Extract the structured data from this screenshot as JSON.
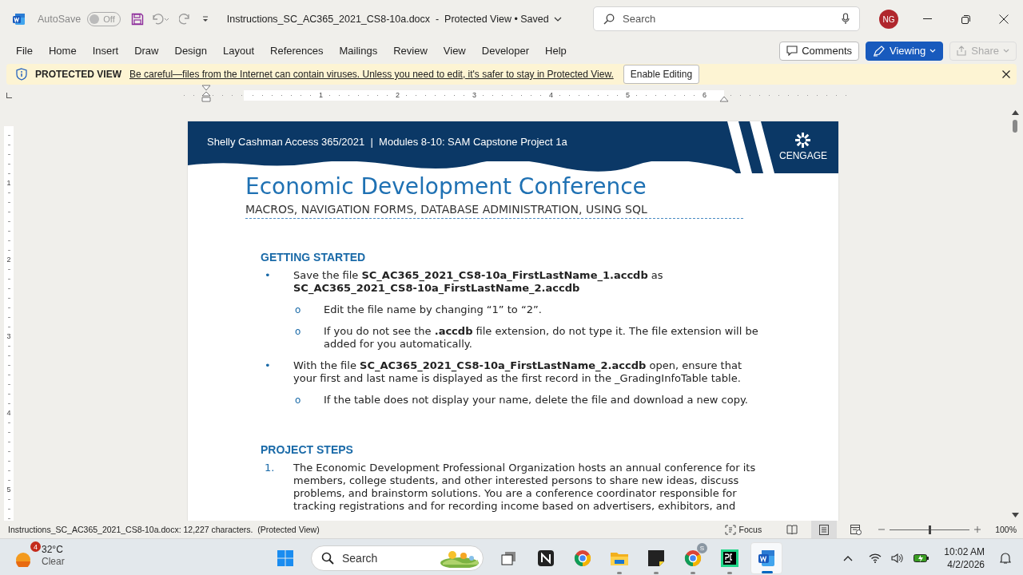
{
  "title_bar": {
    "autosave": {
      "label": "AutoSave",
      "state": "Off",
      "on": false
    },
    "document_title": "Instructions_SC_AC365_2021_CS8-10a.docx  -  Protected View • Saved",
    "search": {
      "placeholder": "Search"
    },
    "avatar": "NG"
  },
  "ribbon": {
    "tabs": [
      {
        "label": "File",
        "selected": false
      },
      {
        "label": "Home",
        "selected": false
      },
      {
        "label": "Insert",
        "selected": false
      },
      {
        "label": "Draw",
        "selected": false
      },
      {
        "label": "Design",
        "selected": false
      },
      {
        "label": "Layout",
        "selected": false
      },
      {
        "label": "References",
        "selected": false
      },
      {
        "label": "Mailings",
        "selected": false
      },
      {
        "label": "Review",
        "selected": false
      },
      {
        "label": "View",
        "selected": false
      },
      {
        "label": "Developer",
        "selected": false
      },
      {
        "label": "Help",
        "selected": false
      }
    ],
    "buttons": [
      {
        "kind": "comments",
        "label": "Comments",
        "disabled": false
      },
      {
        "kind": "viewing",
        "label": "Viewing",
        "disabled": false
      },
      {
        "kind": "share",
        "label": "Share",
        "disabled": true
      }
    ]
  },
  "protected_view": {
    "title": "PROTECTED VIEW",
    "message": "Be careful—files from the Internet can contain viruses. Unless you need to edit, it's safer to stay in Protected View.",
    "button": "Enable Editing"
  },
  "ruler": {
    "horizontal": [
      "1",
      "2",
      "3",
      "4",
      "5",
      "6"
    ],
    "vertical": [
      "1",
      "2",
      "3",
      "4",
      "5"
    ]
  },
  "document": {
    "banner": "Shelly Cashman Access 365/2021  |  Modules 8-10: SAM Capstone Project 1a",
    "brand": "CENGAGE",
    "title": "Economic Development Conference",
    "subtitle": "MACROS, NAVIGATION FORMS, DATABASE ADMINISTRATION, USING SQL",
    "sections": [
      {
        "heading": "GETTING STARTED",
        "items": [
          {
            "marker": "•",
            "text": "Save the file **SC_AC365_2021_CS8-10a_FirstLastName_1.accdb** as **SC_AC365_2021_CS8-10a_FirstLastName_2.accdb**",
            "children": [
              {
                "marker": "o",
                "text": "Edit the file name by changing “1” to “2”."
              },
              {
                "marker": "o",
                "text": "If you do not see the **.accdb** file extension, do not type it. The file extension will be added for you automatically."
              }
            ]
          },
          {
            "marker": "•",
            "text": "With the file **SC_AC365_2021_CS8-10a_FirstLastName_2.accdb** open, ensure that your first and last name is displayed as the first record in the _GradingInfoTable table.",
            "children": [
              {
                "marker": "o",
                "text": "If the table does not display your name, delete the file and download a new copy."
              }
            ]
          }
        ]
      },
      {
        "heading": "PROJECT STEPS",
        "items": [
          {
            "marker": "1.",
            "text": "The Economic Development Professional Organization hosts an annual conference for its members, college students, and other interested persons to share new ideas, discuss problems, and brainstorm solutions. You are a conference coordinator responsible for tracking registrations and for recording income based on advertisers, exhibitors, and"
          }
        ]
      }
    ]
  },
  "status_bar": {
    "text": "Instructions_SC_AC365_2021_CS8-10a.docx: 12,227 characters.  (Protected View)",
    "focus": "Focus",
    "views": [
      {
        "kind": "read",
        "selected": false
      },
      {
        "kind": "print",
        "selected": true
      },
      {
        "kind": "web",
        "selected": false
      }
    ],
    "zoom": {
      "level": 0.5,
      "reading": "100%"
    }
  },
  "taskbar": {
    "weather": {
      "badge": "4",
      "temperature": "32°C",
      "condition": "Clear"
    },
    "search": {
      "placeholder": "Search"
    },
    "apps": [
      {
        "kind": "taskview",
        "running": false,
        "active": false
      },
      {
        "kind": "notebook",
        "running": false,
        "active": false
      },
      {
        "kind": "browser",
        "running": false,
        "active": false
      },
      {
        "kind": "folder",
        "running": true,
        "active": false
      },
      {
        "kind": "sticky",
        "running": true,
        "active": false
      },
      {
        "kind": "browser",
        "running": true,
        "active": false,
        "badge": "S"
      },
      {
        "kind": "ide",
        "running": true,
        "active": false
      },
      {
        "kind": "word",
        "running": true,
        "active": true
      }
    ],
    "time": "10:02 AM",
    "date": "4/2/2026"
  }
}
